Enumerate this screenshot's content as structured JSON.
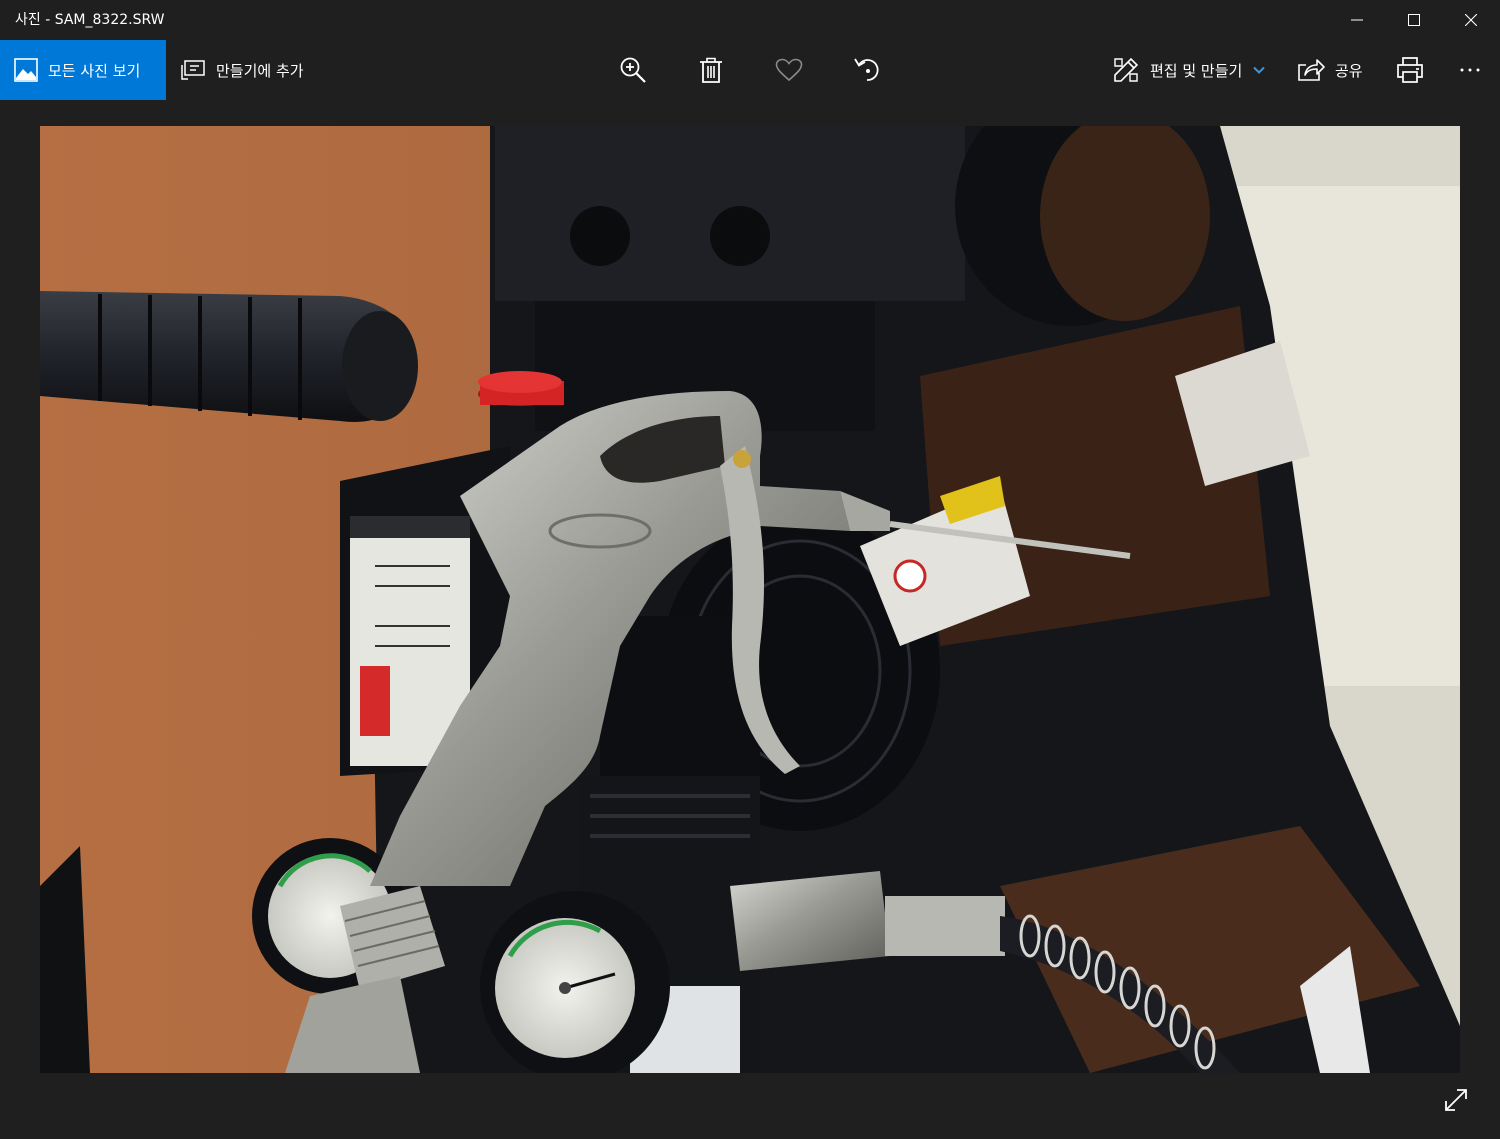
{
  "window": {
    "title": "사진 - SAM_8322.SRW"
  },
  "toolbar": {
    "all_photos_label": "모든 사진 보기",
    "add_creation_label": "만들기에 추가",
    "edit_create_label": "편집 및 만들기",
    "share_label": "공유"
  },
  "icons": {
    "all_photos": "photo-gallery-icon",
    "add_creation": "add-to-creation-icon",
    "zoom": "zoom-in-icon",
    "delete": "trash-icon",
    "favorite": "heart-icon",
    "rotate": "rotate-icon",
    "edit": "edit-create-icon",
    "dropdown": "chevron-down-icon",
    "share": "share-icon",
    "print": "printer-icon",
    "more": "more-icon",
    "fullscreen": "expand-icon"
  },
  "colors": {
    "background": "#1f1f1f",
    "accent": "#0078d7",
    "foreground": "#ffffff"
  }
}
